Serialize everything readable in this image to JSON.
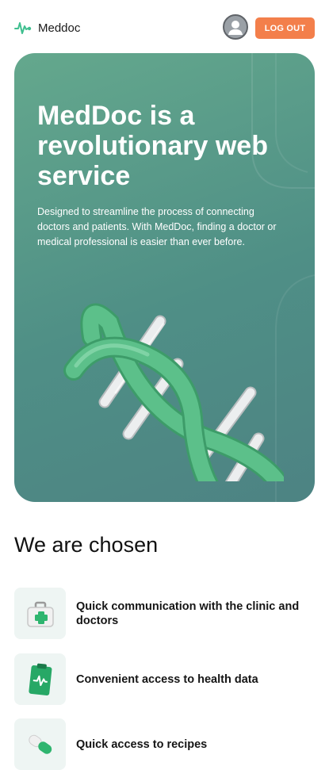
{
  "header": {
    "logo_text": "Meddoc",
    "logout_label": "LOG OUT"
  },
  "hero": {
    "title": "MedDoc is a revolutionary web service",
    "description": "Designed to streamline the process of connecting doctors and patients. With MedDoc, finding a doctor or medical professional is easier than ever before."
  },
  "section": {
    "title": "We are chosen"
  },
  "features": [
    {
      "label": "Quick communication with the clinic and doctors",
      "icon": "first-aid-kit-icon"
    },
    {
      "label": "Convenient access to health data",
      "icon": "health-clipboard-icon"
    },
    {
      "label": "Quick access to recipes",
      "icon": "pill-capsule-icon"
    }
  ],
  "colors": {
    "accent": "#f37f4b",
    "hero_green": "#5a9e89",
    "mint": "#5cc08a"
  }
}
